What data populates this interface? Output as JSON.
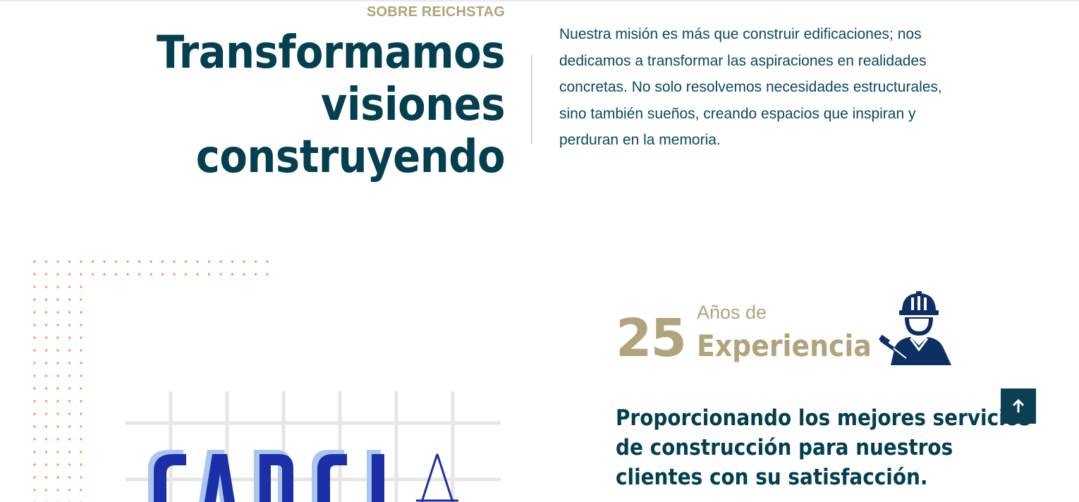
{
  "about": {
    "eyebrow": "SOBRE REICHSTAG",
    "headline": [
      "Transformamos",
      "visiones",
      "construyendo"
    ],
    "mission": "Nuestra misión es más que construir edificaciones; nos dedicamos a transformar las aspiraciones en realidades concretas. No solo resolvemos necesidades estructurales, sino también sueños, creando espacios que inspiran y perduran en la memoria."
  },
  "experience": {
    "years": "25",
    "label": "Años de",
    "title": "Experiencia",
    "icon": "construction-worker-icon"
  },
  "services": {
    "text": "Proporcionando los mejores servicios de construcción para nuestros clientes con su satisfacción."
  },
  "image": {
    "icon": "garcia-logo-grid-image"
  },
  "back_to_top": {
    "icon": "arrow-up-icon"
  },
  "colors": {
    "primary": "#03404f",
    "accent": "#b0a47c",
    "dots": "#f0a070",
    "logo_blue": "#1b2fa8"
  }
}
